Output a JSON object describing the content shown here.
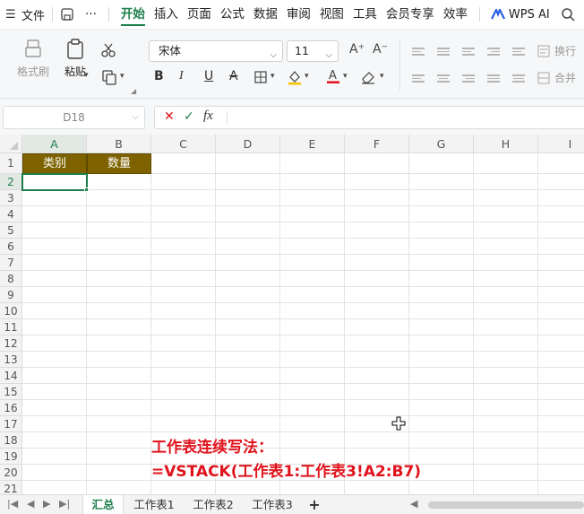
{
  "menubar": {
    "file": "文件",
    "more": "···",
    "tabs": [
      "开始",
      "插入",
      "页面",
      "公式",
      "数据",
      "审阅",
      "视图",
      "工具",
      "会员专享",
      "效率"
    ],
    "active_tab": "开始",
    "ai_label": "WPS AI"
  },
  "toolbar": {
    "format_painter": "格式刷",
    "paste": "粘贴",
    "font_name": "宋体",
    "font_size": "11",
    "wrap": "换行",
    "merge": "合并"
  },
  "formula_bar": {
    "name_box": "D18",
    "formula": ""
  },
  "sheet": {
    "columns": [
      "A",
      "B",
      "C",
      "D",
      "E",
      "F",
      "G",
      "H",
      "I"
    ],
    "rows": [
      "1",
      "2",
      "3",
      "4",
      "5",
      "6",
      "7",
      "8",
      "9",
      "10",
      "11",
      "12",
      "13",
      "14",
      "15",
      "16",
      "17",
      "18",
      "19",
      "20",
      "21"
    ],
    "header_cells": [
      "类别",
      "数量"
    ],
    "annotation_line1": "工作表连续写法：",
    "annotation_line2": "=VSTACK(工作表1:工作表3!A2:B7)"
  },
  "tabs": {
    "sheets": [
      "汇总",
      "工作表1",
      "工作表2",
      "工作表3"
    ],
    "active": "汇总",
    "add": "+"
  },
  "colors": {
    "accent": "#1d7d4b",
    "header_fill": "#7e6200",
    "annotation": "#e0121b"
  }
}
